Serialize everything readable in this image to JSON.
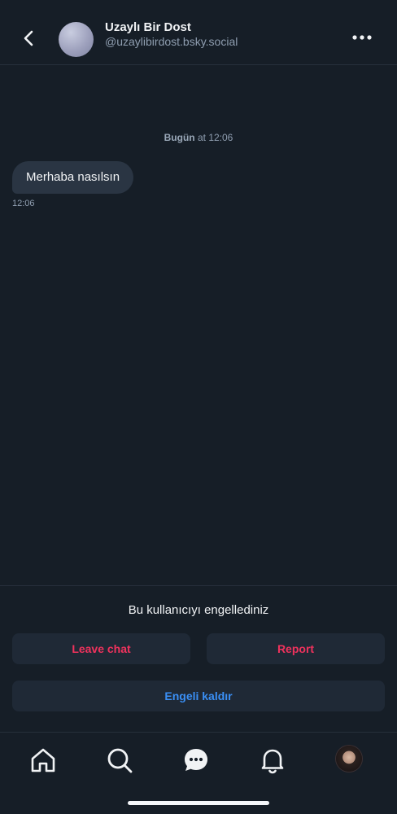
{
  "header": {
    "name": "Uzaylı Bir Dost",
    "handle": "@uzaylibirdost.bsky.social",
    "back_icon": "chevron-left-icon",
    "more_icon": "ellipsis-horizontal-icon"
  },
  "conversation": {
    "date_separator": {
      "day": "Bugün",
      "rest": " at 12:06"
    },
    "messages": [
      {
        "text": "Merhaba nasılsın",
        "time": "12:06"
      }
    ]
  },
  "blocked_panel": {
    "title": "Bu kullanıcıyı engellediniz",
    "leave_label": "Leave chat",
    "report_label": "Report",
    "unblock_label": "Engeli kaldır"
  },
  "tabbar": {
    "icons": [
      "home-icon",
      "search-icon",
      "chat-bubble-icon",
      "bell-icon",
      "profile-avatar"
    ]
  },
  "colors": {
    "background": "#161e27",
    "bubble": "#2a3543",
    "button_bg": "#1f2936",
    "danger": "#f0325d",
    "link_blue": "#3a8ff5",
    "muted_text": "#8f9eb0"
  }
}
